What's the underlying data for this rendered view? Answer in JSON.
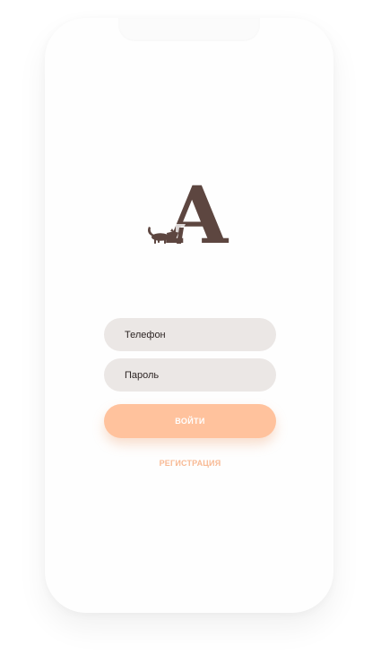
{
  "login": {
    "phone_placeholder": "Телефон",
    "password_placeholder": "Пароль",
    "login_button_label": "ВОЙТИ",
    "register_link_label": "РЕГИСТРАЦИЯ"
  },
  "logo": {
    "letter": "A",
    "icon": "cat-silhouette-icon"
  },
  "colors": {
    "accent": "#ffc29d",
    "link": "#f8ba95",
    "field_background": "#ebe7e5",
    "logo_brown": "#5d4640"
  }
}
